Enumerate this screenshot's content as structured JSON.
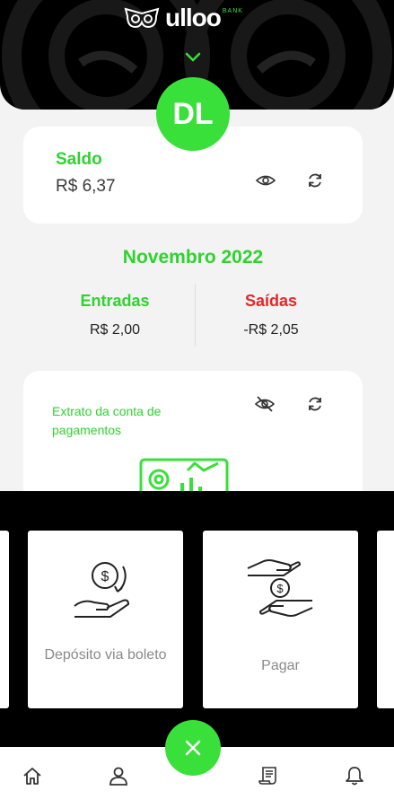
{
  "header": {
    "brand": "ulloo",
    "bank_tag": "BANK"
  },
  "avatar": {
    "initials": "DL"
  },
  "balance_card": {
    "title": "Saldo",
    "value": "R$ 6,37"
  },
  "summary": {
    "month": "Novembro 2022",
    "income_label": "Entradas",
    "income_value": "R$ 2,00",
    "outgoing_label": "Saídas",
    "outgoing_value": "-R$ 2,05"
  },
  "statement_card": {
    "text": "Extrato da conta de pagamentos"
  },
  "actions": [
    {
      "label": "Depósito via boleto",
      "icon": "hand-coin-refresh-icon"
    },
    {
      "label": "Pagar",
      "icon": "hands-exchange-money-icon"
    }
  ],
  "nav": {
    "items": [
      "home-icon",
      "profile-icon",
      "receipt-icon",
      "bell-icon"
    ]
  },
  "colors": {
    "accent": "#39e03a",
    "accent_text": "#2fd230",
    "negative": "#e4262c",
    "dark": "#000000"
  }
}
